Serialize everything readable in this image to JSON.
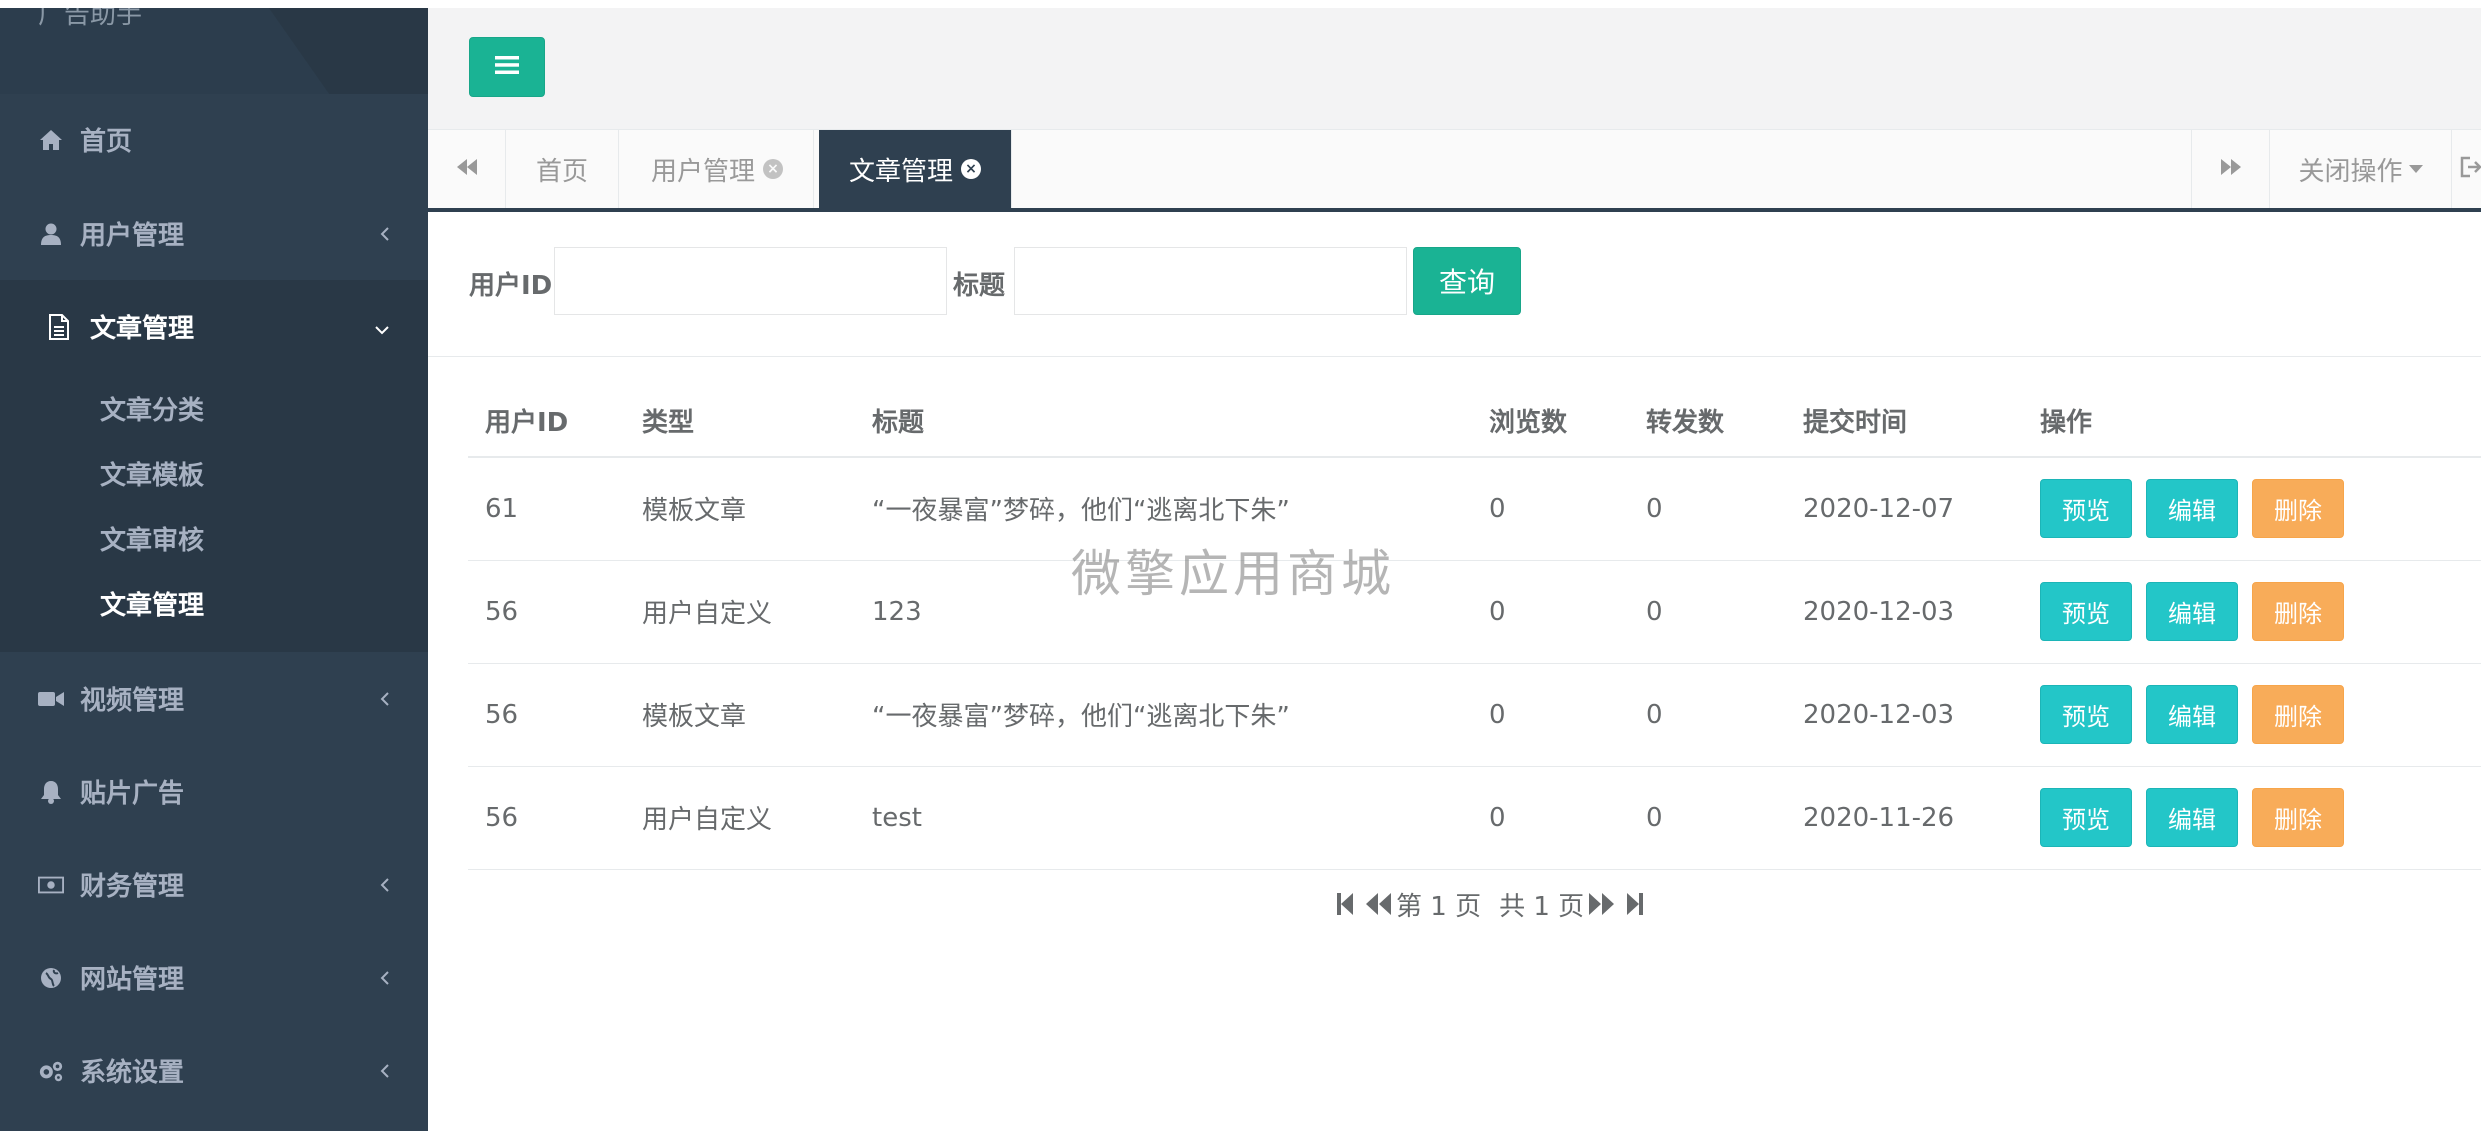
{
  "sidebar": {
    "brand": "广告助手",
    "items": [
      {
        "label": "首页",
        "icon": "home-icon"
      },
      {
        "label": "用户管理",
        "icon": "user-icon"
      },
      {
        "label": "文章管理",
        "icon": "file-text-icon"
      },
      {
        "label": "视频管理",
        "icon": "video-camera-icon"
      },
      {
        "label": "贴片广告",
        "icon": "bell-icon"
      },
      {
        "label": "财务管理",
        "icon": "money-icon"
      },
      {
        "label": "网站管理",
        "icon": "globe-icon"
      },
      {
        "label": "系统设置",
        "icon": "gears-icon"
      }
    ],
    "article_subitems": [
      "文章分类",
      "文章模板",
      "文章审核",
      "文章管理"
    ]
  },
  "tabs": {
    "items": [
      "首页",
      "用户管理",
      "文章管理"
    ],
    "close_ops": "关闭操作"
  },
  "search": {
    "user_id_label": "用户ID",
    "title_label": "标题",
    "user_id_value": "",
    "title_value": "",
    "button": "查询"
  },
  "table": {
    "headers": [
      "用户ID",
      "类型",
      "标题",
      "浏览数",
      "转发数",
      "提交时间",
      "操作"
    ],
    "rows": [
      {
        "user_id": "61",
        "type": "模板文章",
        "title": "“一夜暴富”梦碎，他们“逃离北下朱”",
        "views": "0",
        "shares": "0",
        "time": "2020-12-07"
      },
      {
        "user_id": "56",
        "type": "用户自定义",
        "title": "123",
        "views": "0",
        "shares": "0",
        "time": "2020-12-03"
      },
      {
        "user_id": "56",
        "type": "模板文章",
        "title": "“一夜暴富”梦碎，他们“逃离北下朱”",
        "views": "0",
        "shares": "0",
        "time": "2020-12-03"
      },
      {
        "user_id": "56",
        "type": "用户自定义",
        "title": "test",
        "views": "0",
        "shares": "0",
        "time": "2020-11-26"
      }
    ],
    "actions": {
      "preview": "预览",
      "edit": "编辑",
      "delete": "删除"
    }
  },
  "pagination": {
    "current": "第 1 页",
    "total": "共 1 页"
  },
  "watermark": "微擎应用商城",
  "colors": {
    "sidebar_bg": "#2f4050",
    "primary": "#1ab394",
    "info": "#23c6c8",
    "warning": "#f8ac59"
  }
}
